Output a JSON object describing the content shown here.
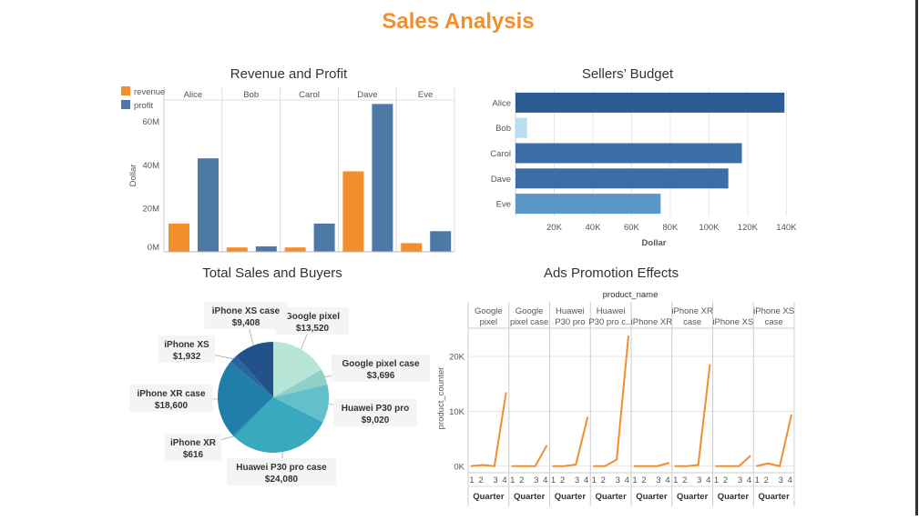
{
  "dashboard_title": "Sales Analysis",
  "colors": {
    "title": "#f28e2b",
    "revenue": "#f28e2b",
    "profit": "#4e79a7",
    "ads_line": "#f28e2b",
    "grid": "#e6e6e6",
    "axis_text": "#555555"
  },
  "chart_data": [
    {
      "id": "revenue_profit",
      "type": "bar",
      "title": "Revenue and Profit",
      "categories": [
        "Alice",
        "Bob",
        "Carol",
        "Dave",
        "Eve"
      ],
      "series": [
        {
          "name": "revenue",
          "color": "#f28e2b",
          "values": [
            13,
            2,
            2,
            37,
            4
          ]
        },
        {
          "name": "profit",
          "color": "#4e79a7",
          "values": [
            43,
            2.5,
            13,
            68,
            9.5
          ]
        }
      ],
      "ylabel": "Dollar",
      "yticks": [
        "0M",
        "20M",
        "40M",
        "60M"
      ],
      "ytick_values": [
        0,
        20,
        40,
        60
      ],
      "ylim": [
        0,
        69
      ],
      "legend": "top-left",
      "grid": false
    },
    {
      "id": "sellers_budget",
      "type": "bar",
      "orientation": "horizontal",
      "title": "Sellers’ Budget",
      "categories": [
        "Alice",
        "Bob",
        "Carol",
        "Dave",
        "Eve"
      ],
      "values": [
        139000,
        6000,
        117000,
        110000,
        75000
      ],
      "colors": [
        "#2b5d94",
        "#b9ddf1",
        "#3a6ea5",
        "#3a6ea5",
        "#5b96c9"
      ],
      "xlabel": "Dollar",
      "xticks": [
        "20K",
        "40K",
        "60K",
        "80K",
        "100K",
        "120K",
        "140K"
      ],
      "xtick_values": [
        20000,
        40000,
        60000,
        80000,
        100000,
        120000,
        140000
      ],
      "xlim": [
        0,
        145000
      ],
      "grid": true
    },
    {
      "id": "total_sales_buyers",
      "type": "pie",
      "title": "Total Sales and Buyers",
      "slices": [
        {
          "label": "Google pixel",
          "value_label": "$13,520",
          "value": 13520,
          "color": "#b7e6d8"
        },
        {
          "label": "Google pixel case",
          "value_label": "$3,696",
          "value": 3696,
          "color": "#8fd0c8"
        },
        {
          "label": "Huawei P30 pro",
          "value_label": "$9,020",
          "value": 9020,
          "color": "#63bfc9"
        },
        {
          "label": "Huawei P30 pro case",
          "value_label": "$24,080",
          "value": 24080,
          "color": "#38a9bf"
        },
        {
          "label": "iPhone XR",
          "value_label": "$616",
          "value": 616,
          "color": "#2a93b3"
        },
        {
          "label": "iPhone XR case",
          "value_label": "$18,600",
          "value": 18600,
          "color": "#1f7fa8"
        },
        {
          "label": "iPhone XS",
          "value_label": "$1,932",
          "value": 1932,
          "color": "#2766a0"
        },
        {
          "label": "iPhone XS case",
          "value_label": "$9,408",
          "value": 9408,
          "color": "#23528a"
        }
      ]
    },
    {
      "id": "ads_promotion",
      "type": "line",
      "title": "Ads Promotion Effects",
      "column_header": "product_name",
      "ylabel": "product_counter",
      "xlabel": "Quarter",
      "x": [
        "1",
        "2",
        "3",
        "4"
      ],
      "yticks": [
        "0K",
        "10K",
        "20K"
      ],
      "ytick_values": [
        0,
        10000,
        20000
      ],
      "ylim": [
        -1200,
        25000
      ],
      "panels": [
        {
          "name": "Google pixel",
          "name_lines": [
            "Google",
            "pixel"
          ],
          "values": [
            0,
            200,
            0,
            13500
          ]
        },
        {
          "name": "Google pixel case",
          "name_lines": [
            "Google",
            "pixel case"
          ],
          "values": [
            0,
            0,
            0,
            3800
          ]
        },
        {
          "name": "Huawei P30 pro",
          "name_lines": [
            "Huawei",
            "P30 pro"
          ],
          "values": [
            0,
            0,
            300,
            9000
          ]
        },
        {
          "name": "Huawei P30 pro c...",
          "name_lines": [
            "Huawei",
            "P30 pro c..."
          ],
          "values": [
            0,
            0,
            1200,
            23800
          ]
        },
        {
          "name": "iPhone XR",
          "name_lines": [
            "iPhone XR"
          ],
          "values": [
            0,
            0,
            0,
            600
          ]
        },
        {
          "name": "iPhone XR case",
          "name_lines": [
            "iPhone XR",
            "case"
          ],
          "values": [
            0,
            0,
            200,
            18600
          ]
        },
        {
          "name": "iPhone XS",
          "name_lines": [
            "iPhone XS"
          ],
          "values": [
            0,
            0,
            0,
            1900
          ]
        },
        {
          "name": "iPhone XS case",
          "name_lines": [
            "iPhone XS",
            "case"
          ],
          "values": [
            0,
            500,
            0,
            9400
          ]
        }
      ]
    }
  ]
}
